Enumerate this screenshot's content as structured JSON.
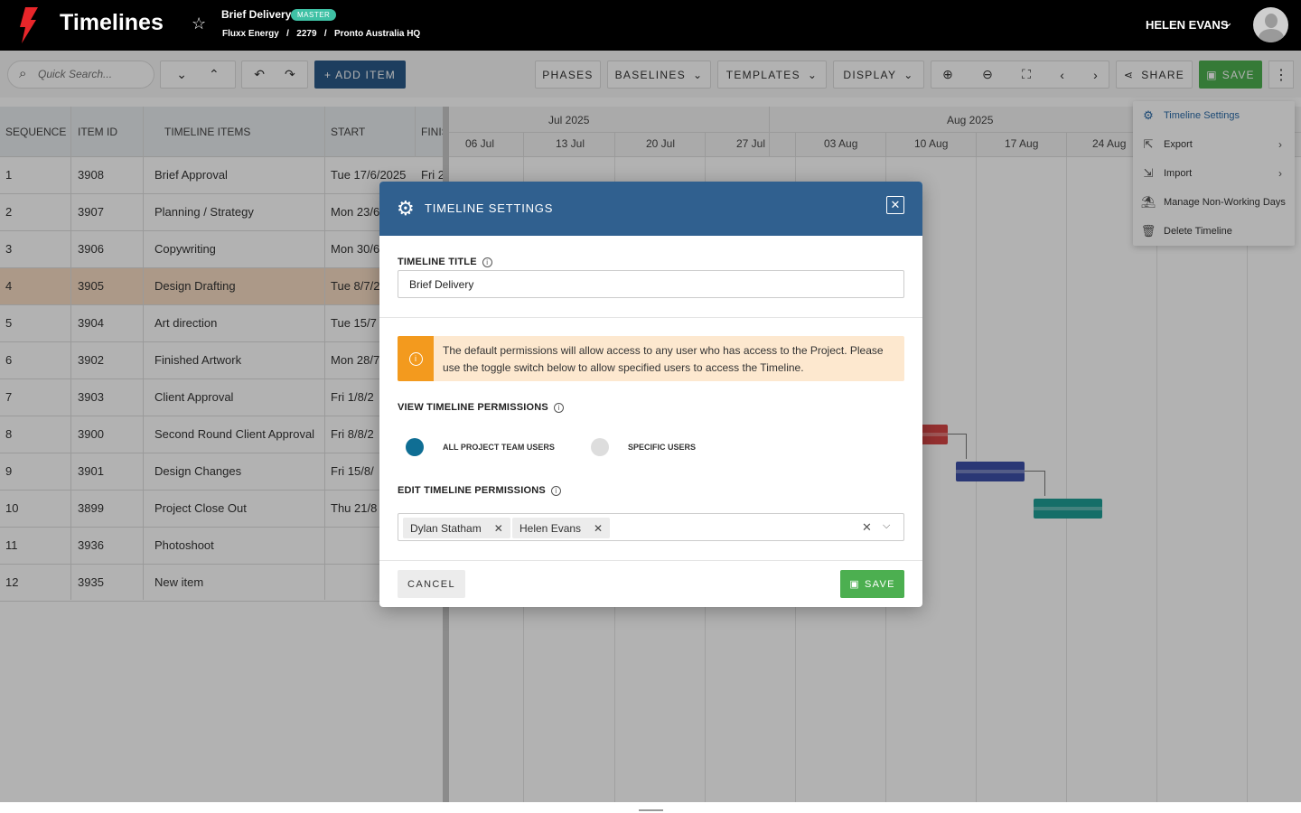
{
  "topbar": {
    "app_title": "Timelines",
    "project_name": "Brief Delivery",
    "badge": "MASTER",
    "breadcrumb": [
      "Fluxx Energy",
      "2279",
      "Pronto Australia HQ"
    ],
    "breadcrumb_sep": "/",
    "user_name": "HELEN EVANS"
  },
  "toolbar": {
    "search_placeholder": "Quick Search...",
    "add_item": "+ ADD ITEM",
    "phases": "PHASES",
    "baselines": "BASELINES",
    "templates": "TEMPLATES",
    "display": "DISPLAY",
    "share": "SHARE",
    "save": "SAVE"
  },
  "grid": {
    "columns": [
      "SEQUENCE",
      "ITEM ID",
      "TIMELINE ITEMS",
      "START",
      "FINIS"
    ],
    "rows": [
      {
        "seq": "1",
        "id": "3908",
        "name": "Brief Approval",
        "start": "Tue 17/6/2025",
        "finish": "Fri 2"
      },
      {
        "seq": "2",
        "id": "3907",
        "name": "Planning / Strategy",
        "start": "Mon 23/6",
        "finish": ""
      },
      {
        "seq": "3",
        "id": "3906",
        "name": "Copywriting",
        "start": "Mon 30/6",
        "finish": ""
      },
      {
        "seq": "4",
        "id": "3905",
        "name": "Design Drafting",
        "start": "Tue 8/7/2",
        "finish": ""
      },
      {
        "seq": "5",
        "id": "3904",
        "name": "Art direction",
        "start": "Tue 15/7",
        "finish": ""
      },
      {
        "seq": "6",
        "id": "3902",
        "name": "Finished Artwork",
        "start": "Mon 28/7",
        "finish": ""
      },
      {
        "seq": "7",
        "id": "3903",
        "name": "Client Approval",
        "start": "Fri 1/8/2",
        "finish": ""
      },
      {
        "seq": "8",
        "id": "3900",
        "name": "Second Round Client Approval",
        "start": "Fri 8/8/2",
        "finish": ""
      },
      {
        "seq": "9",
        "id": "3901",
        "name": "Design Changes",
        "start": "Fri 15/8/",
        "finish": ""
      },
      {
        "seq": "10",
        "id": "3899",
        "name": "Project Close Out",
        "start": "Thu 21/8",
        "finish": ""
      },
      {
        "seq": "11",
        "id": "3936",
        "name": "Photoshoot",
        "start": "",
        "finish": ""
      },
      {
        "seq": "12",
        "id": "3935",
        "name": "New item",
        "start": "",
        "finish": ""
      }
    ]
  },
  "gantt": {
    "months": [
      "Jul 2025",
      "Aug 2025"
    ],
    "weeks": [
      "06 Jul",
      "13 Jul",
      "20 Jul",
      "27 Jul",
      "03 Aug",
      "10 Aug",
      "17 Aug",
      "24 Aug"
    ],
    "bar_colors": [
      "#d64545",
      "#3d4fa8",
      "#1f9e96"
    ]
  },
  "menu": {
    "items": [
      {
        "label": "Timeline Settings",
        "icon": "gear-icon",
        "active": true
      },
      {
        "label": "Export",
        "icon": "export-icon",
        "submenu": true
      },
      {
        "label": "Import",
        "icon": "import-icon",
        "submenu": true
      },
      {
        "label": "Manage Non-Working Days",
        "icon": "calendar-off-icon"
      },
      {
        "label": "Delete Timeline",
        "icon": "trash-icon"
      }
    ]
  },
  "modal": {
    "title": "TIMELINE SETTINGS",
    "title_label": "TIMELINE TITLE",
    "title_value": "Brief Delivery",
    "notice": "The default permissions will allow access to any user who has access to the Project. Please use the toggle switch below to allow specified users to access the Timeline.",
    "view_label": "VIEW TIMELINE PERMISSIONS",
    "option_all": "ALL PROJECT TEAM USERS",
    "option_specific": "SPECIFIC USERS",
    "selected_option": "all",
    "edit_label": "EDIT TIMELINE PERMISSIONS",
    "edit_users": [
      "Dylan Statham",
      "Helen Evans"
    ],
    "cancel": "CANCEL",
    "save": "SAVE"
  },
  "colors": {
    "topbar": "#000000",
    "modal_header": "#30608f",
    "save_green": "#4caf50",
    "add_item_blue": "#2a5a88",
    "notice_bg": "#fde8cf",
    "notice_icon": "#f39a1e",
    "radio_on": "#0f6e94",
    "logo_red": "#e8262a"
  }
}
